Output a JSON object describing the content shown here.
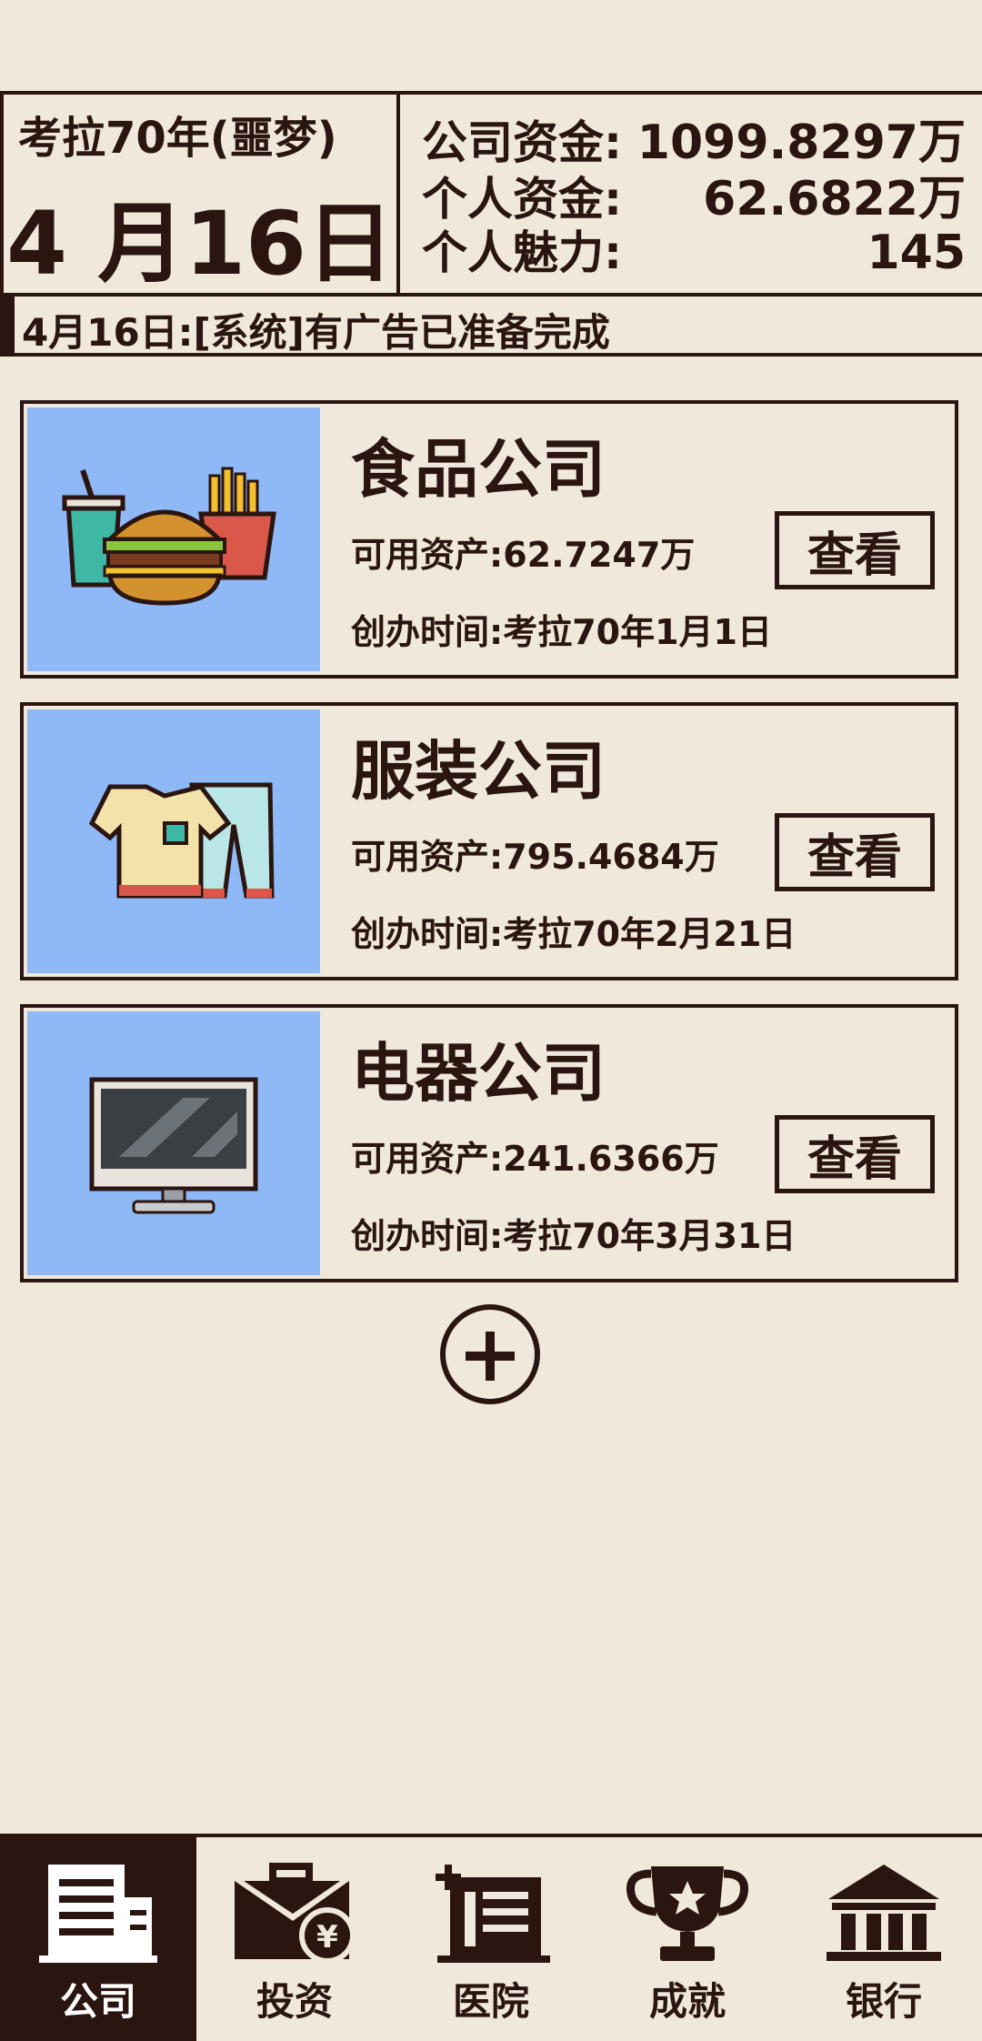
{
  "header": {
    "year_label": "考拉70年(噩梦)",
    "date": "4 月16日",
    "stats": [
      {
        "label": "公司资金:",
        "value": "1099.8297万"
      },
      {
        "label": "个人资金:",
        "value": "62.6822万"
      },
      {
        "label": "个人魅力:",
        "value": "145"
      }
    ]
  },
  "ticker": {
    "message": "4月16日:[系统]有广告已准备完成"
  },
  "companies": [
    {
      "name": "食品公司",
      "assets": "可用资产:62.7247万",
      "founded": "创办时间:考拉70年1月1日",
      "icon": "burger-fries-icon",
      "view_label": "查看"
    },
    {
      "name": "服装公司",
      "assets": "可用资产:795.4684万",
      "founded": "创办时间:考拉70年2月21日",
      "icon": "clothes-icon",
      "view_label": "查看"
    },
    {
      "name": "电器公司",
      "assets": "可用资产:241.6366万",
      "founded": "创办时间:考拉70年3月31日",
      "icon": "monitor-icon",
      "view_label": "查看"
    }
  ],
  "add_button": {
    "icon": "plus-circle-icon"
  },
  "nav": [
    {
      "label": "公司",
      "icon": "building-icon",
      "active": true
    },
    {
      "label": "投资",
      "icon": "briefcase-yen-icon",
      "active": false
    },
    {
      "label": "医院",
      "icon": "hospital-icon",
      "active": false
    },
    {
      "label": "成就",
      "icon": "trophy-icon",
      "active": false
    },
    {
      "label": "银行",
      "icon": "bank-icon",
      "active": false
    }
  ],
  "colors": {
    "background": "#efe8db",
    "ink": "#2a1511",
    "card_image_bg": "#8fb8f6",
    "nav_active_bg": "#2a1511"
  }
}
